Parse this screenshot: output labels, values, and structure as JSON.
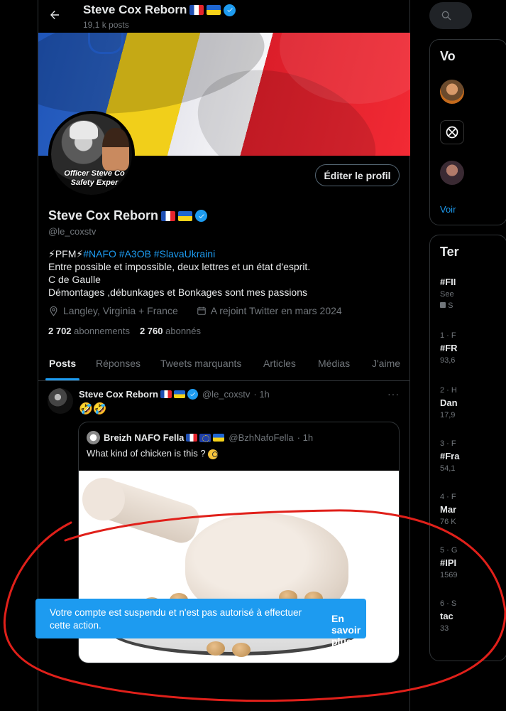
{
  "colors": {
    "accent": "#1d9bf0",
    "background": "#000000",
    "toast": "#1d9bf0",
    "annotation": "#e0201a"
  },
  "header": {
    "title": "Steve Cox Reborn",
    "posts_count": "19,1 k posts"
  },
  "profile": {
    "name": "Steve Cox Reborn",
    "handle": "@le_coxstv",
    "avatar_caption_1": "Officer Steve Co",
    "avatar_caption_2": "Safety Exper",
    "edit_button": "Éditer le profil",
    "bio_line1_prefix": "⚡PFM⚡",
    "bio_tags": "#NAFO #A3OB #SlavaUkraini",
    "bio_line2": "Entre possible et impossible, deux lettres et un état d'esprit.",
    "bio_line3": "C de Gaulle",
    "bio_line4": "Démontages ,débunkages et Bonkages sont mes passions",
    "location": "Langley, Virginia + France",
    "joined": "A rejoint Twitter en mars 2024",
    "following_count": "2 702",
    "following_label": "abonnements",
    "followers_count": "2 760",
    "followers_label": "abonnés"
  },
  "tabs": [
    {
      "label": "Posts",
      "active": true
    },
    {
      "label": "Réponses"
    },
    {
      "label": "Tweets marquants"
    },
    {
      "label": "Articles"
    },
    {
      "label": "Médias"
    },
    {
      "label": "J'aime"
    }
  ],
  "tweet": {
    "name": "Steve Cox Reborn",
    "handle": "@le_coxstv",
    "time": "· 1h",
    "text": "🤣🤣",
    "more": "···",
    "quote": {
      "name": "Breizh NAFO Fella",
      "handle": "@BzhNafoFella",
      "time": "· 1h",
      "text": "What kind of chicken is this ?"
    }
  },
  "toast": {
    "message": "Votre compte est suspendu et n'est pas autorisé à effectuer cette action.",
    "link": "En savoir plus"
  },
  "right": {
    "who_title": "Vo",
    "see_more": "Voir",
    "trends_title": "Ter",
    "trends": [
      {
        "meta": "",
        "name": "#FII",
        "count": "See"
      },
      {
        "meta": "1 · F",
        "name": "#FR",
        "count": "93,6"
      },
      {
        "meta": "2 · H",
        "name": "Dan",
        "count": "17,9"
      },
      {
        "meta": "3 · F",
        "name": "#Fra",
        "count": "54,1"
      },
      {
        "meta": "4 · F",
        "name": "Mar",
        "count": "76 K"
      },
      {
        "meta": "5 · G",
        "name": "#IPI",
        "count": "1569"
      },
      {
        "meta": "6 · S",
        "name": "tac",
        "count": "33"
      }
    ],
    "trend0_extra": "S"
  }
}
